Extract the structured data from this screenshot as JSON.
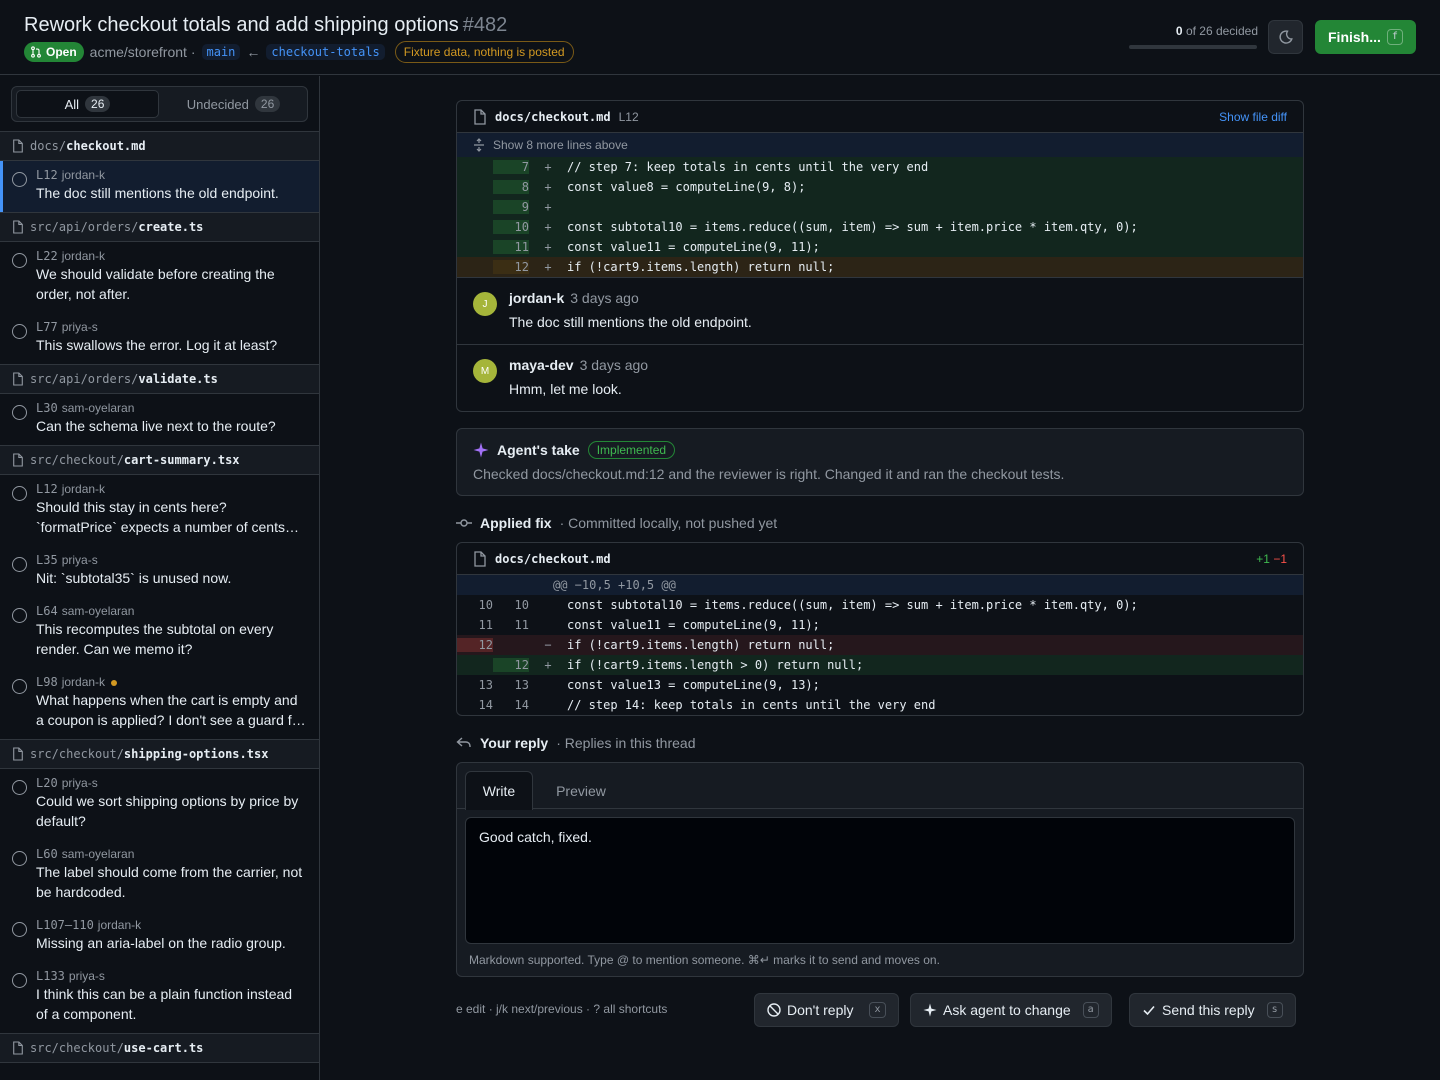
{
  "header": {
    "title": "Rework checkout totals and add shipping options",
    "number": "#482",
    "status": "Open",
    "repo": "acme/storefront ·",
    "base_branch": "main",
    "arrow": "←",
    "head_branch": "checkout-totals",
    "fixture_notice": "Fixture data, nothing is posted",
    "decided_count": "0",
    "decided_suffix": "of 26 decided",
    "decided_progress": 0,
    "finish_label": "Finish...",
    "finish_key": "f"
  },
  "sidebar": {
    "filters": [
      {
        "label": "All",
        "count": "26"
      },
      {
        "label": "Undecided",
        "count": "26"
      }
    ],
    "groups": [
      {
        "dir": "docs/",
        "file": "checkout.md",
        "comments": [
          {
            "line": "L12",
            "author": "jordan-k",
            "text": "The doc still mentions the old endpoint.",
            "selected": true
          }
        ]
      },
      {
        "dir": "src/api/orders/",
        "file": "create.ts",
        "comments": [
          {
            "line": "L22",
            "author": "jordan-k",
            "text": "We should validate before creating the order, not after."
          },
          {
            "line": "L77",
            "author": "priya-s",
            "text": "This swallows the error. Log it at least?"
          }
        ]
      },
      {
        "dir": "src/api/orders/",
        "file": "validate.ts",
        "comments": [
          {
            "line": "L30",
            "author": "sam-oyelaran",
            "text": "Can the schema live next to the route?"
          }
        ]
      },
      {
        "dir": "src/checkout/",
        "file": "cart-summary.tsx",
        "comments": [
          {
            "line": "L12",
            "author": "jordan-k",
            "text": "Should this stay in cents here? `formatPrice` expects a number of cents and rounds on display."
          },
          {
            "line": "L35",
            "author": "priya-s",
            "text": "Nit: `subtotal35` is unused now."
          },
          {
            "line": "L64",
            "author": "sam-oyelaran",
            "text": "This recomputes the subtotal on every render. Can we memo it?"
          },
          {
            "line": "L98",
            "author": "jordan-k",
            "text": "What happens when the cart is empty and a coupon is applied? I don't see a guard for that case.",
            "dot": true
          }
        ]
      },
      {
        "dir": "src/checkout/",
        "file": "shipping-options.tsx",
        "comments": [
          {
            "line": "L20",
            "author": "priya-s",
            "text": "Could we sort shipping options by price by default?"
          },
          {
            "line": "L60",
            "author": "sam-oyelaran",
            "text": "The label should come from the carrier, not be hardcoded."
          },
          {
            "line": "L107–110",
            "author": "jordan-k",
            "text": "Missing an aria-label on the radio group."
          },
          {
            "line": "L133",
            "author": "priya-s",
            "text": "I think this can be a plain function instead of a component."
          }
        ]
      },
      {
        "dir": "src/checkout/",
        "file": "use-cart.ts",
        "comments": []
      }
    ]
  },
  "thread": {
    "file": "docs/checkout.md",
    "line": "L12",
    "show_file_diff": "Show file diff",
    "expander": "Show 8 more lines above",
    "lines": [
      {
        "n": "7",
        "sign": "+",
        "code": "// step 7: keep totals in cents until the very end"
      },
      {
        "n": "8",
        "sign": "+",
        "code": "const value8 = computeLine(9, 8);"
      },
      {
        "n": "9",
        "sign": "+",
        "code": ""
      },
      {
        "n": "10",
        "sign": "+",
        "code": "const subtotal10 = items.reduce((sum, item) => sum + item.price * item.qty, 0);"
      },
      {
        "n": "11",
        "sign": "+",
        "code": "const value11 = computeLine(9, 11);"
      },
      {
        "n": "12",
        "sign": "+",
        "code": "if (!cart9.items.length) return null;",
        "highlight": true
      }
    ],
    "comments": [
      {
        "initial": "J",
        "author": "jordan-k",
        "when": "3 days ago",
        "text": "The doc still mentions the old endpoint."
      },
      {
        "initial": "M",
        "author": "maya-dev",
        "when": "3 days ago",
        "text": "Hmm, let me look."
      }
    ]
  },
  "agent": {
    "label": "Agent's take",
    "badge": "Implemented",
    "text": "Checked docs/checkout.md:12 and the reviewer is right. Changed it and ran the checkout tests."
  },
  "fix": {
    "title": "Applied fix",
    "subtitle": "· Committed locally, not pushed yet",
    "file": "docs/checkout.md",
    "additions": "+1",
    "deletions": "−1",
    "hunk": "@@ −10,5 +10,5 @@",
    "lines": [
      {
        "old": "10",
        "new": "10",
        "sign": "",
        "code": "const subtotal10 = items.reduce((sum, item) => sum + item.price * item.qty, 0);",
        "kind": "ctx"
      },
      {
        "old": "11",
        "new": "11",
        "sign": "",
        "code": "const value11 = computeLine(9, 11);",
        "kind": "ctx"
      },
      {
        "old": "12",
        "new": "",
        "sign": "−",
        "code": "if (!cart9.items.length) return null;",
        "kind": "del"
      },
      {
        "old": "",
        "new": "12",
        "sign": "+",
        "code": "if (!cart9.items.length > 0) return null;",
        "kind": "add"
      },
      {
        "old": "13",
        "new": "13",
        "sign": "",
        "code": "const value13 = computeLine(9, 13);",
        "kind": "ctx"
      },
      {
        "old": "14",
        "new": "14",
        "sign": "",
        "code": "// step 14: keep totals in cents until the very end",
        "kind": "ctx"
      }
    ]
  },
  "reply": {
    "title": "Your reply",
    "subtitle": "· Replies in this thread",
    "tab_write": "Write",
    "tab_preview": "Preview",
    "value": "Good catch, fixed.",
    "hint": "Markdown supported. Type @ to mention someone. ⌘↵ marks it to send and moves on."
  },
  "actions": {
    "shortcuts": "e edit · j/k next/previous · ? all shortcuts",
    "dont_reply": "Don't reply",
    "dont_reply_key": "x",
    "ask_agent": "Ask agent to change",
    "ask_agent_key": "a",
    "send": "Send this reply",
    "send_key": "s"
  }
}
